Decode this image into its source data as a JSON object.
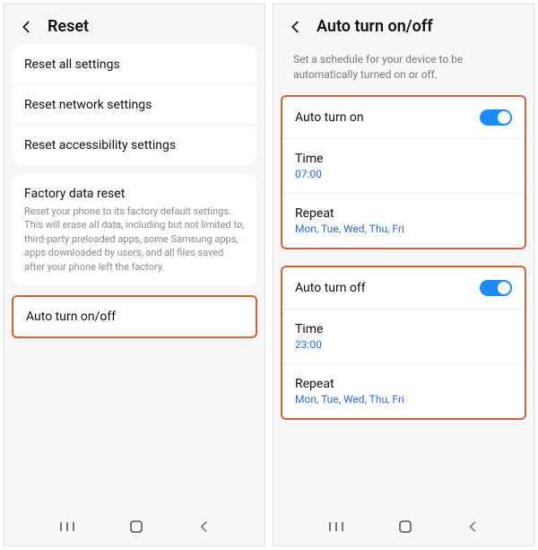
{
  "left": {
    "title": "Reset",
    "items": {
      "reset_all": "Reset all settings",
      "reset_network": "Reset network settings",
      "reset_accessibility": "Reset accessibility settings",
      "factory_title": "Factory data reset",
      "factory_desc": "Reset your phone to its factory default settings. This will erase all data, including but not limited to, third-party preloaded apps, some Samsung apps, apps downloaded by users, and all files saved after your phone left the factory.",
      "auto_turn": "Auto turn on/off"
    }
  },
  "right": {
    "title": "Auto turn on/off",
    "intro": "Set a schedule for your device to be automatically turned on or off.",
    "section_on": {
      "label": "Auto turn on",
      "time_label": "Time",
      "time_value": "07:00",
      "repeat_label": "Repeat",
      "repeat_value": "Mon, Tue, Wed, Thu, Fri"
    },
    "section_off": {
      "label": "Auto turn off",
      "time_label": "Time",
      "time_value": "23:00",
      "repeat_label": "Repeat",
      "repeat_value": "Mon, Tue, Wed, Thu, Fri"
    }
  }
}
